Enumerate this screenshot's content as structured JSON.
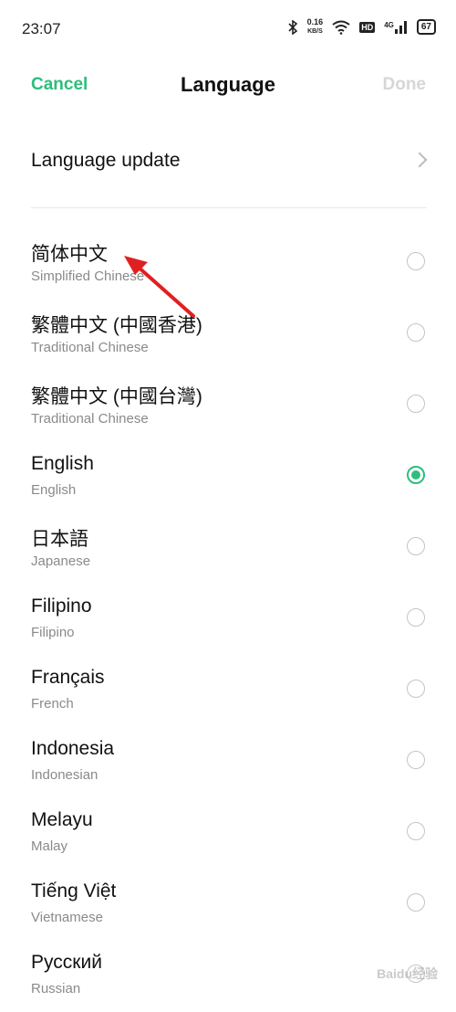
{
  "status_bar": {
    "time": "23:07",
    "bluetooth_icon": "bluetooth-icon",
    "net_speed_value": "0.16",
    "net_speed_unit": "KB/S",
    "wifi_icon": "wifi-icon",
    "hd_label": "HD",
    "network_type": "4G",
    "signal_icon": "signal-icon",
    "battery_level": "67"
  },
  "header": {
    "cancel_label": "Cancel",
    "title": "Language",
    "done_label": "Done"
  },
  "language_update": {
    "label": "Language update",
    "chevron_icon": "chevron-right-icon"
  },
  "languages": [
    {
      "name": "简体中文",
      "subtitle": "Simplified Chinese",
      "selected": false
    },
    {
      "name": "繁體中文 (中國香港)",
      "subtitle": "Traditional Chinese",
      "selected": false
    },
    {
      "name": "繁體中文 (中國台灣)",
      "subtitle": "Traditional Chinese",
      "selected": false
    },
    {
      "name": "English",
      "subtitle": "English",
      "selected": true
    },
    {
      "name": "日本語",
      "subtitle": "Japanese",
      "selected": false
    },
    {
      "name": "Filipino",
      "subtitle": "Filipino",
      "selected": false
    },
    {
      "name": "Français",
      "subtitle": "French",
      "selected": false
    },
    {
      "name": "Indonesia",
      "subtitle": "Indonesian",
      "selected": false
    },
    {
      "name": "Melayu",
      "subtitle": "Malay",
      "selected": false
    },
    {
      "name": "Tiếng Việt",
      "subtitle": "Vietnamese",
      "selected": false
    },
    {
      "name": "Русский",
      "subtitle": "Russian",
      "selected": false
    }
  ],
  "colors": {
    "accent": "#2ebd7d",
    "annotation_arrow": "#e02020",
    "disabled_text": "#d6d6d6"
  },
  "watermark": "Baidu经验"
}
